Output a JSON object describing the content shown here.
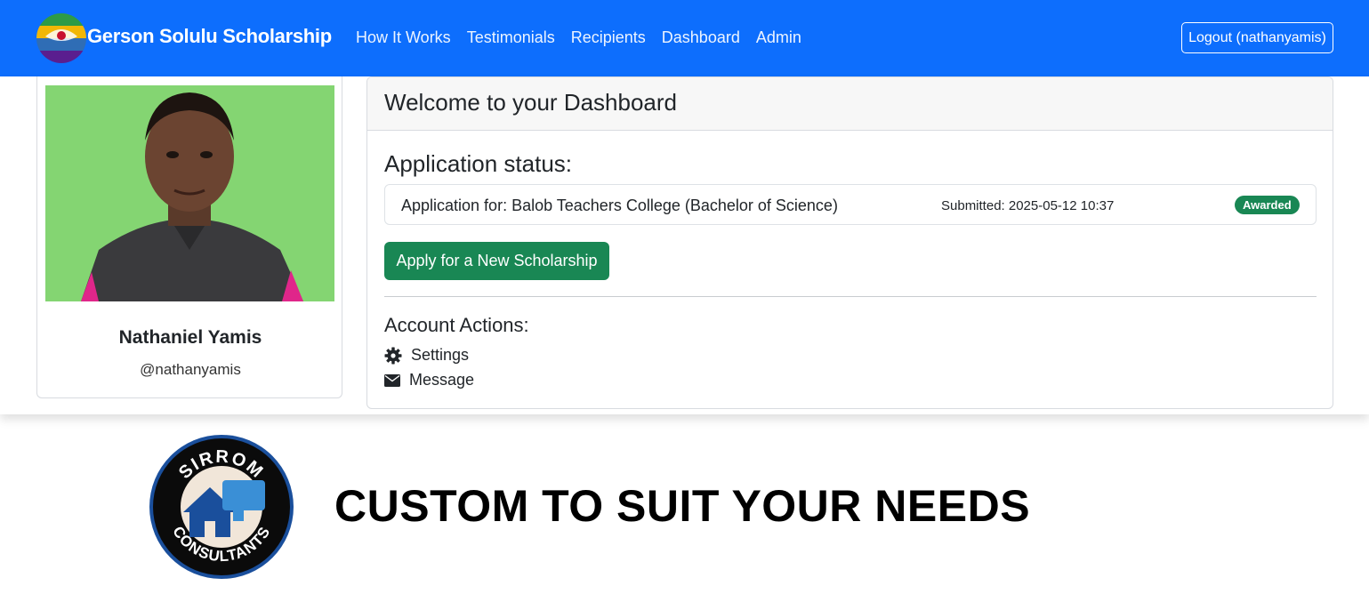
{
  "nav": {
    "brand": "Gerson Solulu Scholarship",
    "links": [
      "How It Works",
      "Testimonials",
      "Recipients",
      "Dashboard",
      "Admin"
    ],
    "logout": "Logout (nathanyamis)"
  },
  "profile": {
    "name": "Nathaniel Yamis",
    "username": "@nathanyamis"
  },
  "dashboard": {
    "title": "Welcome to your Dashboard",
    "status_title": "Application status:",
    "application": {
      "for": "Application for: Balob Teachers College (Bachelor of Science)",
      "submitted": "Submitted: 2025-05-12 10:37",
      "status": "Awarded"
    },
    "apply_button": "Apply for a New Scholarship",
    "actions_title": "Account Actions:",
    "actions": [
      {
        "label": "Settings",
        "icon": "gear-icon"
      },
      {
        "label": "Message",
        "icon": "envelope-icon"
      }
    ]
  },
  "footer": {
    "logo_text_top": "SIRROM",
    "logo_text_bottom": "CONSULTANTS",
    "tagline": "CUSTOM TO SUIT YOUR NEEDS"
  },
  "colors": {
    "primary": "#0d6efd",
    "success": "#198754",
    "photo_background": "#7fd36e"
  }
}
